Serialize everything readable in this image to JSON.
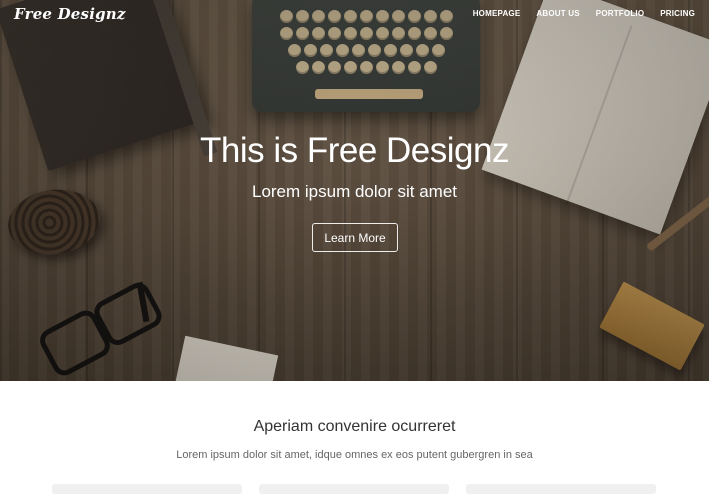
{
  "brand": {
    "name": "Free Designz"
  },
  "nav": {
    "items": [
      {
        "label": "HOMEPAGE"
      },
      {
        "label": "ABOUT US"
      },
      {
        "label": "PORTFOLIO"
      },
      {
        "label": "PRICING"
      }
    ]
  },
  "hero": {
    "title": "This is Free Designz",
    "subtitle": "Lorem ipsum dolor sit amet",
    "button_label": "Learn More",
    "overlay_color": "#5d4f40"
  },
  "section": {
    "heading": "Aperiam convenire ocurreret",
    "text": "Lorem ipsum dolor sit amet, idque omnes ex eos putent gubergren in sea"
  },
  "colors": {
    "text_primary": "#333333",
    "text_secondary": "#666666",
    "hero_text": "#ffffff"
  }
}
